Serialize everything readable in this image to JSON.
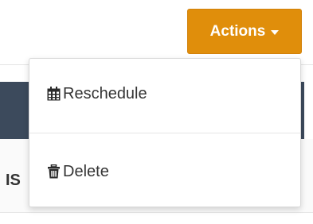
{
  "background": {
    "cut_text": "IS"
  },
  "actions_button": {
    "label": "Actions",
    "color": "#e08e0b"
  },
  "dropdown": {
    "items": [
      {
        "label": "Reschedule",
        "icon": "calendar-icon"
      },
      {
        "label": "Delete",
        "icon": "trash-icon"
      }
    ]
  }
}
